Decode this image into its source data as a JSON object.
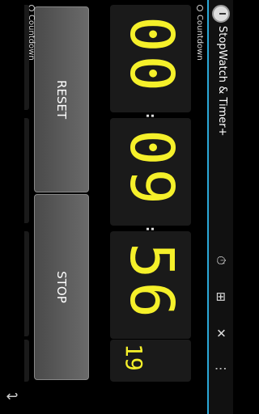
{
  "app": {
    "title": "StopWatch & Timer+"
  },
  "actionbar": {
    "icons": [
      "lap-timer-icon",
      "add-timer-icon",
      "fullscreen-icon",
      "overflow-menu-icon"
    ]
  },
  "main": {
    "label": "Countdown",
    "hours": "00",
    "minutes": "09",
    "seconds": "56",
    "hundredths": "19",
    "colon1": ":",
    "colon2": ":"
  },
  "controls": {
    "reset_label": "RESET",
    "stop_label": "STOP"
  },
  "secondary": {
    "label": "Countdown"
  },
  "nav": {
    "back": "↩",
    "home": "⌂",
    "recents": "▯"
  },
  "colors": {
    "digits": "#f5f02a",
    "accent": "#2aa8d8"
  }
}
